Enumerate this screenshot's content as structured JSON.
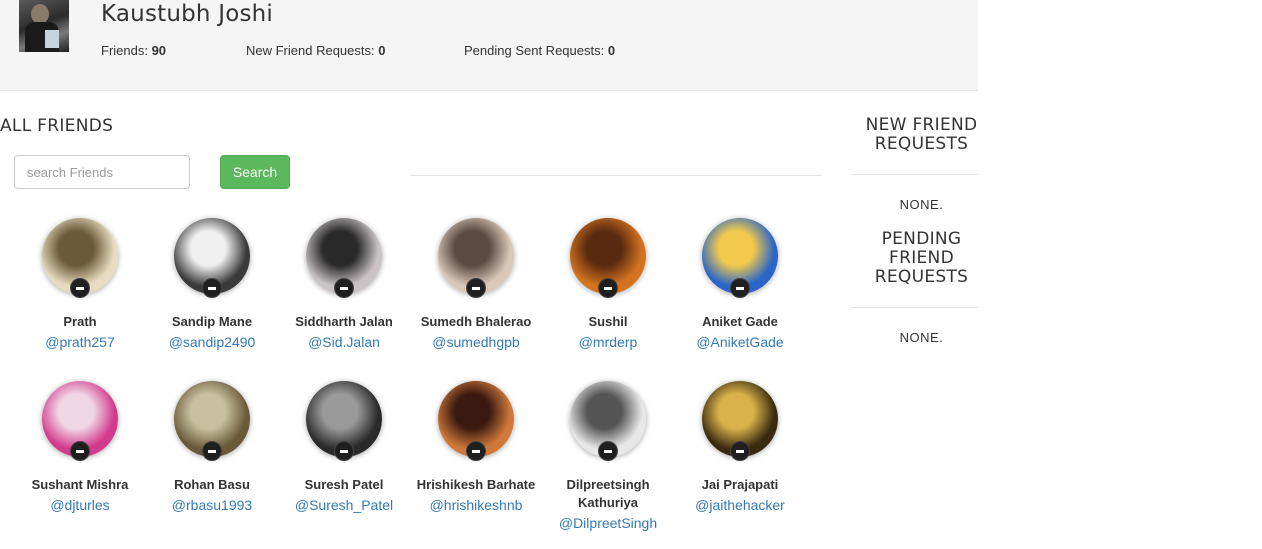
{
  "profile": {
    "name": "Kaustubh Joshi",
    "stats": {
      "friends_label": "Friends: ",
      "friends_count": "90",
      "new_requests_label": "New Friend Requests: ",
      "new_requests_count": "0",
      "pending_sent_label": "Pending Sent Requests: ",
      "pending_sent_count": "0"
    }
  },
  "all_friends": {
    "title": "ALL FRIENDS",
    "search_placeholder": "search Friends",
    "search_button": "Search",
    "friends": [
      {
        "name": "Prath",
        "handle": "@prath257",
        "colors": [
          "#e8dcc0",
          "#6b5a3a"
        ]
      },
      {
        "name": "Sandip Mane",
        "handle": "@sandip2490",
        "colors": [
          "#3a3a3a",
          "#f0f0f0"
        ]
      },
      {
        "name": "Siddharth Jalan",
        "handle": "@Sid.Jalan",
        "colors": [
          "#c9c3c6",
          "#2a2a2a"
        ]
      },
      {
        "name": "Sumedh Bhalerao",
        "handle": "@sumedhgpb",
        "colors": [
          "#d9c7b8",
          "#5a4a40"
        ]
      },
      {
        "name": "Sushil",
        "handle": "@mrderp",
        "colors": [
          "#d4731f",
          "#5a2a10"
        ]
      },
      {
        "name": "Aniket Gade",
        "handle": "@AniketGade",
        "colors": [
          "#2a66c8",
          "#f2c94c"
        ]
      },
      {
        "name": "Sushant Mishra",
        "handle": "@djturles",
        "colors": [
          "#d23a8c",
          "#f0d7e6"
        ]
      },
      {
        "name": "Rohan Basu",
        "handle": "@rbasu1993",
        "colors": [
          "#6a5a3a",
          "#c8c0a0"
        ]
      },
      {
        "name": "Suresh Patel",
        "handle": "@Suresh_Patel",
        "colors": [
          "#2a2a2a",
          "#9a9a9a"
        ]
      },
      {
        "name": "Hrishikesh Barhate",
        "handle": "@hrishikeshnb",
        "colors": [
          "#d0783a",
          "#3a1a10"
        ]
      },
      {
        "name": "Dilpreetsingh Kathuriya",
        "handle": "@DilpreetSingh",
        "colors": [
          "#e8e8e8",
          "#555555"
        ]
      },
      {
        "name": "Jai Prajapati",
        "handle": "@jaithehacker",
        "colors": [
          "#3a2a10",
          "#d9b34a"
        ]
      }
    ]
  },
  "sidebar": {
    "new_requests_title": "NEW FRIEND REQUESTS",
    "new_requests_value": "NONE.",
    "pending_requests_title": "PENDING FRIEND REQUESTS",
    "pending_requests_value": "NONE."
  }
}
